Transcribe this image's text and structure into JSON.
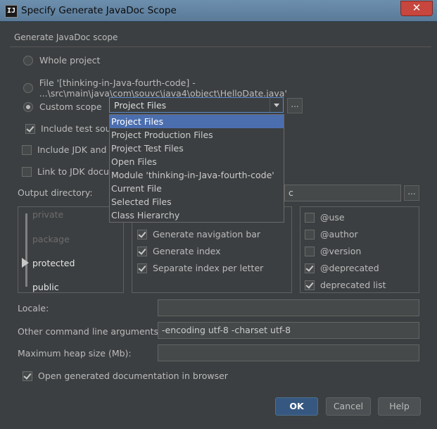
{
  "window": {
    "title": "Specify Generate JavaDoc Scope",
    "close_symbol": "✕",
    "app_icon_text": "IJ"
  },
  "scope_group": {
    "title": "Generate JavaDoc scope",
    "whole_project": "Whole project",
    "file": "File '[thinking-in-Java-fourth-code] - ...\\src\\main\\java\\com\\souvc\\java4\\object\\HelloDate.java'",
    "custom_scope": "Custom scope",
    "custom_scope_value": "Project Files",
    "include_test_sources": "Include test sour",
    "include_jdk": "Include JDK and li",
    "link_jdk": "Link to JDK docum",
    "dropdown_items": [
      "Project Files",
      "Project Production Files",
      "Project Test Files",
      "Open Files",
      "Module 'thinking-in-Java-fourth-code'",
      "Current File",
      "Selected Files",
      "Class Hierarchy"
    ]
  },
  "output": {
    "label": "Output directory:",
    "value": "c",
    "browse": "..."
  },
  "levels": {
    "private": "private",
    "package": "package",
    "protected": "protected",
    "public": "public"
  },
  "options": {
    "navigation_bar": "Generate navigation bar",
    "index": "Generate index",
    "separate_index": "Separate index per letter"
  },
  "tags": {
    "use": "@use",
    "author": "@author",
    "version": "@version",
    "deprecated": "@deprecated",
    "deprecated_list": "deprecated list"
  },
  "locale": {
    "label": "Locale:",
    "value": ""
  },
  "cmd_args": {
    "label": "Other command line arguments:",
    "value": "-encoding utf-8 -charset utf-8"
  },
  "heap": {
    "label": "Maximum heap size (Mb):",
    "value": ""
  },
  "open_in_browser": "Open generated documentation in browser",
  "buttons": {
    "ok": "OK",
    "cancel": "Cancel",
    "help": "Help"
  }
}
